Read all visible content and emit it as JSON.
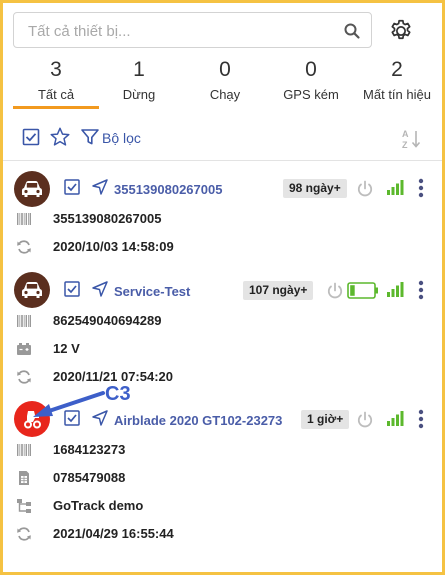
{
  "search": {
    "placeholder": "Tất cả thiết bị..."
  },
  "tabs": [
    {
      "count": "3",
      "label": "Tất cả",
      "active": true
    },
    {
      "count": "1",
      "label": "Dừng"
    },
    {
      "count": "0",
      "label": "Chạy"
    },
    {
      "count": "0",
      "label": "GPS kém"
    },
    {
      "count": "2",
      "label": "Mất tín hiệu"
    }
  ],
  "toolbar": {
    "filter_label": "Bộ lọc"
  },
  "devices": [
    {
      "name": "355139080267005",
      "badge": "98 ngày+",
      "rows": [
        {
          "icon": "barcode-icon",
          "text": "355139080267005"
        },
        {
          "icon": "refresh-icon",
          "text": "2020/10/03 14:58:09"
        }
      ]
    },
    {
      "name": "Service-Test",
      "badge": "107 ngày+",
      "battery_level": 0.2,
      "rows": [
        {
          "icon": "barcode-icon",
          "text": "862549040694289"
        },
        {
          "icon": "battery-power-icon",
          "text": "12 V"
        },
        {
          "icon": "refresh-icon",
          "text": "2020/11/21 07:54:20"
        }
      ]
    },
    {
      "name": "Airblade 2020 GT102-23273",
      "badge": "1 giờ+",
      "rows": [
        {
          "icon": "barcode-icon",
          "text": "1684123273"
        },
        {
          "icon": "sim-card-icon",
          "text": "0785479088"
        },
        {
          "icon": "hierarchy-icon",
          "text": "GoTrack demo"
        },
        {
          "icon": "refresh-icon",
          "text": "2021/04/29 16:55:44"
        }
      ]
    }
  ],
  "annotation": {
    "label": "C3"
  },
  "colors": {
    "accent": "#f29a1f",
    "link": "#4a5da8",
    "signal": "#5cb82d",
    "frame": "#f5c242"
  }
}
